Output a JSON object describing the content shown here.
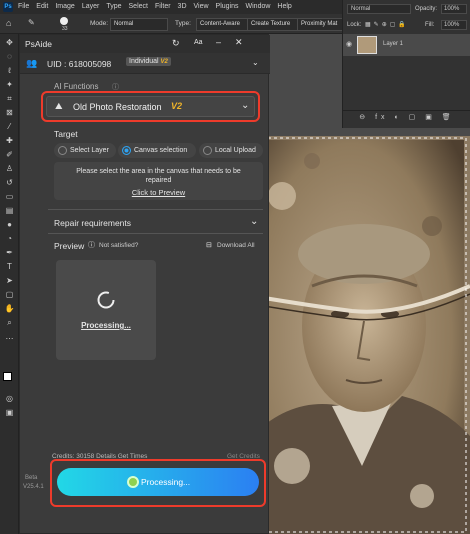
{
  "menubar": {
    "ps_logo": "Ps",
    "items": [
      "File",
      "Edit",
      "Image",
      "Layer",
      "Type",
      "Select",
      "Filter",
      "3D",
      "View",
      "Plugins",
      "Window",
      "Help"
    ]
  },
  "options_bar": {
    "brush_size": "33",
    "mode_label": "Mode:",
    "mode_value": "Normal",
    "type_label": "Type:",
    "type_value": "Content-Aware",
    "create_texture": "Create Texture",
    "proximity": "Proximity Mat"
  },
  "layers_panel": {
    "blend_mode": "Normal",
    "opacity_label": "Opacity:",
    "opacity_value": "100%",
    "lock_label": "Lock:",
    "fill_label": "Fill:",
    "fill_value": "100%",
    "layer_name": "Layer 1",
    "bottom_icons": "⊖ fx ◐ ▢ ▣ 🗑"
  },
  "plugin": {
    "title": "PsAide",
    "uid_text": "UID : 618005098",
    "plan": "Individual",
    "plan_version": "V2",
    "ai_functions_label": "AI Functions",
    "function_name": "Old Photo Restoration",
    "function_version": "V2",
    "target_label": "Target",
    "targets": [
      "Select Layer",
      "Canvas selection",
      "Local Upload"
    ],
    "selected_target": 1,
    "target_hint": "Please select the area in the canvas that needs to be repaired",
    "click_to_preview": "Click to Preview",
    "repair_requirements": "Repair requirements",
    "preview_label": "Preview",
    "not_satisfied": "Not satisfied?",
    "download_all": "Download All",
    "processing_text": "Processing...",
    "credits_text": "Credits: 30158  Details  Get Times",
    "get_credits": "Get Credits",
    "processing_button": "Processing...",
    "version_beta": "Beta",
    "version_num": "V25.4.1"
  },
  "colors": {
    "highlight": "#ee3b2b",
    "button_gradient_start": "#22d8e6",
    "button_gradient_end": "#2b7ff2",
    "accent_blue": "#2ea3f2"
  }
}
